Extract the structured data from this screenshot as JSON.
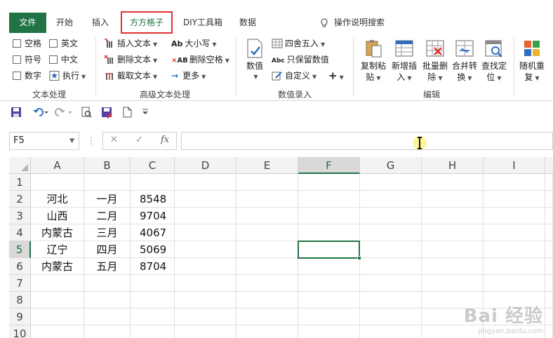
{
  "tabs": {
    "file": "文件",
    "home": "开始",
    "insert": "插入",
    "ffgz": "方方格子",
    "diy": "DIY工具箱",
    "data": "数据",
    "tell_me": "操作说明搜索"
  },
  "ribbon": {
    "text_group": {
      "label": "文本处理",
      "items": [
        "空格",
        "英文",
        "符号",
        "中文",
        "数字",
        "执行"
      ]
    },
    "adv_group": {
      "label": "高级文本处理",
      "insert_text": "插入文本",
      "delete_text": "删除文本",
      "extract_text": "截取文本",
      "case": "大小写",
      "delete_space": "删除空格",
      "more": "更多"
    },
    "num_group": {
      "label": "数值录入",
      "value_btn": "数值",
      "round": "四舍五入",
      "keep_value": "只保留数值",
      "custom": "自定义",
      "plus": "+"
    },
    "edit_group": {
      "label": "编辑",
      "copy_paste": [
        "复制粘",
        "贴"
      ],
      "insert_new": [
        "新增插",
        "入"
      ],
      "batch_delete": [
        "批量删",
        "除"
      ],
      "merge": [
        "合并转",
        "换"
      ],
      "find": [
        "查找定",
        "位"
      ],
      "random": [
        "随机重",
        "复"
      ]
    }
  },
  "name_box": "F5",
  "formula_bar": {
    "cancel": "✕",
    "enter": "✓",
    "fx": "fx",
    "value": ""
  },
  "columns": [
    "A",
    "B",
    "C",
    "D",
    "E",
    "F",
    "G",
    "H",
    "I"
  ],
  "rows": [
    "1",
    "2",
    "3",
    "4",
    "5",
    "6",
    "7",
    "8",
    "9",
    "10"
  ],
  "table": [
    [
      "",
      "",
      ""
    ],
    [
      "河北",
      "一月",
      "8548"
    ],
    [
      "山西",
      "二月",
      "9704"
    ],
    [
      "内蒙古",
      "三月",
      "4067"
    ],
    [
      "辽宁",
      "四月",
      "5069"
    ],
    [
      "内蒙古",
      "五月",
      "8704"
    ]
  ],
  "selected_cell": "F5",
  "watermark": {
    "line1": "Bai 经验",
    "line2": "jingyan.baidu.com"
  },
  "colors": {
    "excel_green": "#217346",
    "highlight_red": "#e0312f"
  }
}
